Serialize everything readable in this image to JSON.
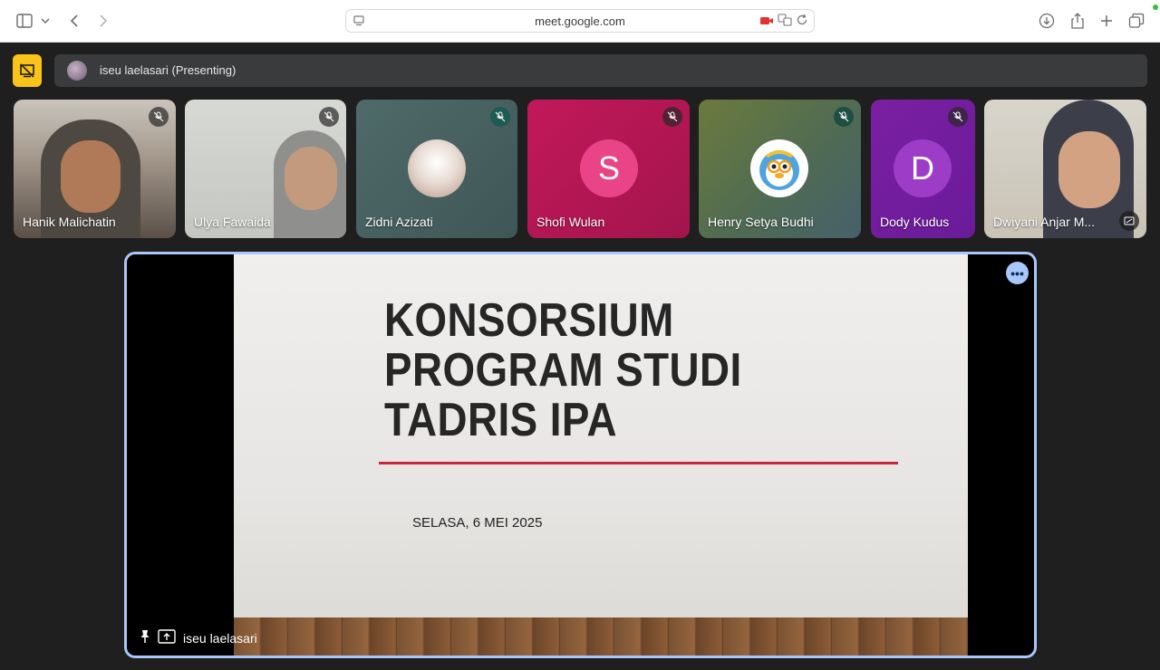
{
  "browser": {
    "url": "meet.google.com"
  },
  "presenting": {
    "label": "iseu laelasari (Presenting)"
  },
  "participants": [
    {
      "name": "Hanik Malichatin"
    },
    {
      "name": "Ulya Fawaida"
    },
    {
      "name": "Zidni Azizati"
    },
    {
      "name": "Shofi Wulan",
      "initial": "S",
      "avatar_color": "#e83e8c"
    },
    {
      "name": "Henry Setya Budhi"
    },
    {
      "name": "Dody Kudus",
      "initial": "D",
      "avatar_color": "#a33fcf"
    },
    {
      "name": "Dwiyani Anjar M..."
    }
  ],
  "stage": {
    "presenter": "iseu laelasari",
    "slide": {
      "title_line1": "KONSORSIUM",
      "title_line2": "PROGRAM STUDI",
      "title_line3": "TADRIS IPA",
      "date": "SELASA, 6 MEI 2025"
    }
  },
  "colors": {
    "accent_yellow": "#f9c31a",
    "stage_border": "#a8c7fa",
    "slide_line": "#c8283d"
  }
}
